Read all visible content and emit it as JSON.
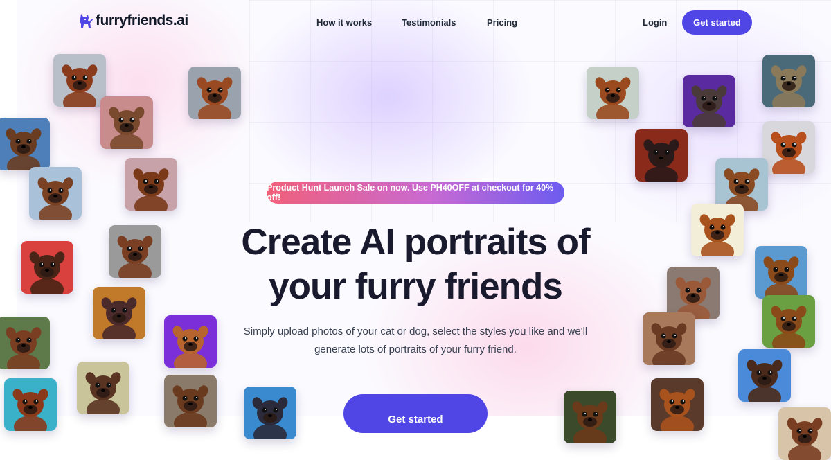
{
  "nav": {
    "logo_text": "furryfriends.ai",
    "links": [
      "How it works",
      "Testimonials",
      "Pricing"
    ],
    "login_label": "Login",
    "cta_label": "Get started"
  },
  "hero": {
    "promo_text": "Product Hunt Launch Sale on now. Use PH40OFF at checkout for 40% off!",
    "headline_line1": "Create AI portraits of",
    "headline_line2": "your furry friends",
    "subhead_line1": "Simply upload photos of your cat or dog, select the styles you like and we'll",
    "subhead_line2": "generate lots of portraits of your furry friend.",
    "cta_label": "Get started"
  },
  "colors": {
    "brand": "#4f46e5",
    "promo_gradient": [
      "#f0607a",
      "#c86ad2",
      "#6d5cf0"
    ],
    "headline": "#1a1a2e"
  },
  "icons": [
    "dog-logo-icon"
  ],
  "portrait_tiles": [
    {
      "name": "pet-portrait-armor",
      "bg": "#b9bfc9",
      "fur": "#8a3b1b"
    },
    {
      "name": "pet-portrait-red-sweater",
      "bg": "#9aa2ad",
      "fur": "#9a4a22"
    },
    {
      "name": "pet-portrait-pink",
      "bg": "#c98c8c",
      "fur": "#7a4a2e"
    },
    {
      "name": "pet-portrait-collar",
      "bg": "#4e7fb8",
      "fur": "#6a3d22"
    },
    {
      "name": "pet-portrait-yellow-scarf",
      "bg": "#a9c2d9",
      "fur": "#7a4122"
    },
    {
      "name": "pet-portrait-painting",
      "bg": "#c7a2a8",
      "fur": "#7a3a1a"
    },
    {
      "name": "pet-portrait-superhero",
      "bg": "#d9413e",
      "fur": "#4a2416"
    },
    {
      "name": "pet-portrait-soldier",
      "bg": "#9a9a9a",
      "fur": "#7a3e22"
    },
    {
      "name": "pet-portrait-golden",
      "bg": "#c07a2a",
      "fur": "#4a2a2a"
    },
    {
      "name": "pet-portrait-neon",
      "bg": "#7a2fd9",
      "fur": "#b8642e"
    },
    {
      "name": "pet-portrait-field",
      "bg": "#5e7a4a",
      "fur": "#7a3e22"
    },
    {
      "name": "pet-portrait-robot",
      "bg": "#c9c49a",
      "fur": "#5a3422"
    },
    {
      "name": "pet-portrait-classic",
      "bg": "#8a7a6a",
      "fur": "#6a3a1e"
    },
    {
      "name": "pet-portrait-cyan",
      "bg": "#3ab0c9",
      "fur": "#8a3a1a"
    },
    {
      "name": "pet-portrait-blue",
      "bg": "#3a8ad0",
      "fur": "#2a2a3a"
    },
    {
      "name": "pet-portrait-mustache",
      "bg": "#c4d0c8",
      "fur": "#9a4a1e"
    },
    {
      "name": "pet-portrait-purple",
      "bg": "#5a2aa0",
      "fur": "#4a3a3a"
    },
    {
      "name": "pet-portrait-fur-coat",
      "bg": "#4a6a7a",
      "fur": "#8a7a5a"
    },
    {
      "name": "pet-portrait-orange",
      "bg": "#d8d8dc",
      "fur": "#b8501e"
    },
    {
      "name": "pet-portrait-bowtie",
      "bg": "#8a2a1a",
      "fur": "#2a1a1a"
    },
    {
      "name": "pet-portrait-sky",
      "bg": "#a8c4d2",
      "fur": "#8a4a22"
    },
    {
      "name": "pet-portrait-cream",
      "bg": "#f2eed8",
      "fur": "#a8521e"
    },
    {
      "name": "pet-portrait-meadow",
      "bg": "#5a9ad0",
      "fur": "#8a4a1a"
    },
    {
      "name": "pet-portrait-hoodie",
      "bg": "#8a7a72",
      "fur": "#9a5a3a"
    },
    {
      "name": "pet-portrait-bandana",
      "bg": "#6aa042",
      "fur": "#8a4a1a"
    },
    {
      "name": "pet-portrait-wood",
      "bg": "#a8795a",
      "fur": "#6a3a22"
    },
    {
      "name": "pet-portrait-cape",
      "bg": "#4a8ad8",
      "fur": "#4a2a1a"
    },
    {
      "name": "pet-portrait-forest",
      "bg": "#3a4a2a",
      "fur": "#6a3a1a"
    },
    {
      "name": "pet-portrait-brown",
      "bg": "#5a3a2a",
      "fur": "#a8521e"
    },
    {
      "name": "pet-portrait-bottom",
      "bg": "#d8c4a8",
      "fur": "#7a3e22"
    }
  ]
}
